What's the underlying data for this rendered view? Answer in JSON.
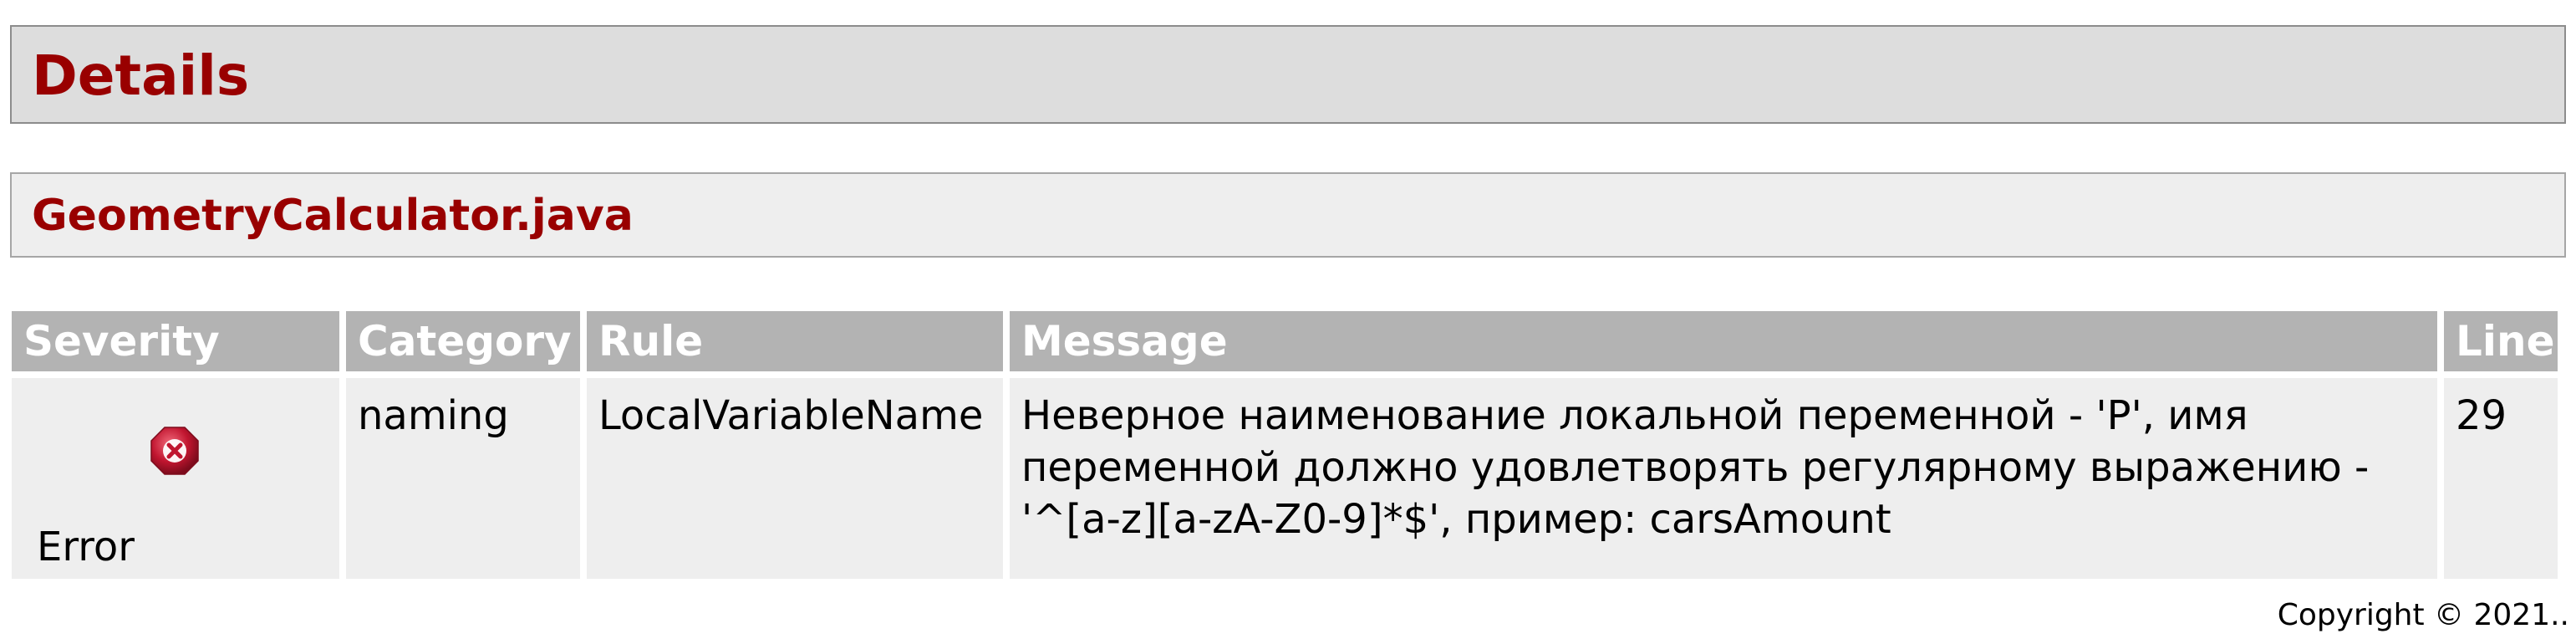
{
  "details": {
    "title": "Details"
  },
  "file": {
    "name": "GeometryCalculator.java"
  },
  "table": {
    "headers": {
      "severity": "Severity",
      "category": "Category",
      "rule": "Rule",
      "message": "Message",
      "line": "Line"
    },
    "rows": [
      {
        "severity_icon": "error-icon",
        "severity": "Error",
        "category": "naming",
        "rule": "LocalVariableName",
        "message": "Неверное наименование локальной переменной - 'P', имя переменной должно удовлетворять регулярному выражению - '^[a-z][a-zA-Z0-9]*$', пример: carsAmount",
        "line": "29"
      }
    ]
  },
  "footer": {
    "copyright": "Copyright © 2021.."
  },
  "colors": {
    "title": "#990000",
    "header_background": "#dddddd",
    "file_background": "#eeeeee",
    "table_header": "#b3b3b3",
    "table_cell": "#eeeeee",
    "error_icon": "#c0152f"
  }
}
